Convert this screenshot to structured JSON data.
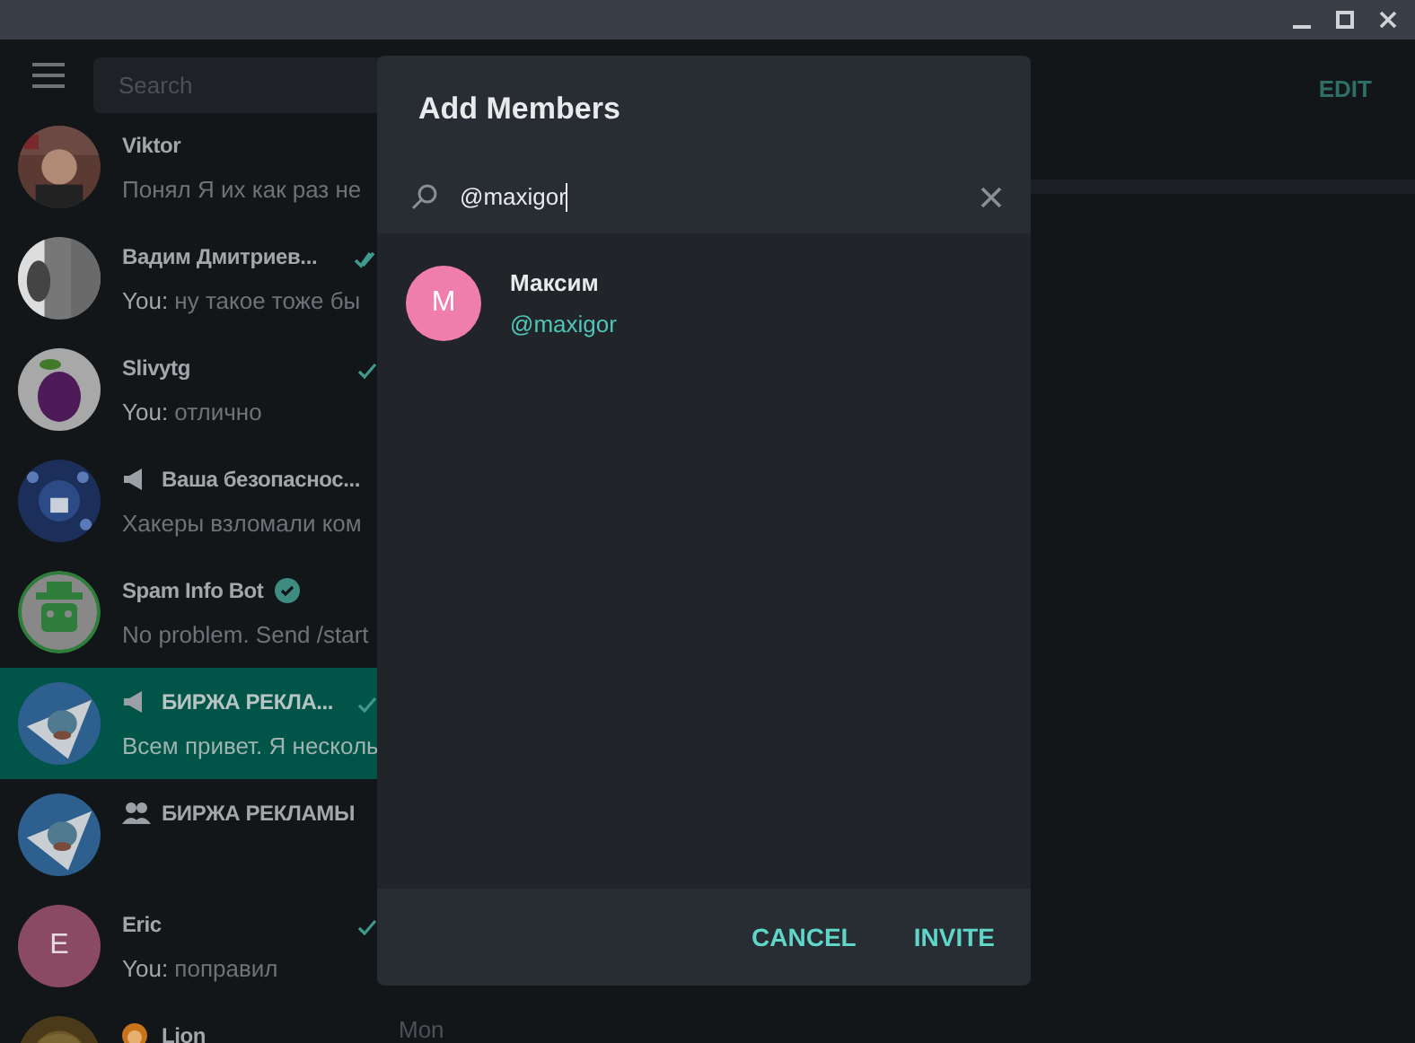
{
  "sidebar": {
    "search": {
      "placeholder": "Search"
    },
    "chats": [
      {
        "kind": "private",
        "name": "Viktor",
        "preview": "Понял Я их как раз не",
        "selected": false
      },
      {
        "kind": "private",
        "name": "Вадим Дмитриев...",
        "sender": "You:",
        "preview": "ну такое тоже бы",
        "sent": true,
        "read": true,
        "selected": false
      },
      {
        "kind": "private",
        "name": "Slivytg",
        "sender": "You:",
        "preview": "отлично",
        "avatar": {
          "kind": "plum"
        },
        "sent": true,
        "read": false,
        "selected": false
      },
      {
        "kind": "channel",
        "name": "Ваша безопаснос...",
        "preview": "Хакеры взломали ком",
        "selected": false
      },
      {
        "kind": "private",
        "name": "Spam Info Bot",
        "preview": "No problem. Send /start",
        "avatar": {
          "kind": "bot"
        },
        "verified": true,
        "selected": false
      },
      {
        "kind": "channel",
        "name": "БИРЖА РЕКЛА...",
        "preview": "Всем привет. Я несколь",
        "sent": true,
        "read": false,
        "selected": true
      },
      {
        "kind": "group",
        "name": "БИРЖА РЕКЛАМЫ",
        "selected": false
      },
      {
        "kind": "private",
        "name": "Eric",
        "sender": "You:",
        "preview": "поправил",
        "avatar": {
          "kind": "letter",
          "letter": "E",
          "color": "#8a4a63"
        },
        "sent": true,
        "read": false,
        "selected": false
      },
      {
        "kind": "emoji",
        "name": "Lion",
        "date": "Mon",
        "selected": false
      }
    ]
  },
  "main": {
    "edit_button": "EDIT"
  },
  "dialog": {
    "title": "Add Members",
    "search": {
      "value": "@maxigor"
    },
    "results": [
      {
        "name": "Максим",
        "username": "@maxigor",
        "avatar": {
          "kind": "letter",
          "letter": "M",
          "color": "#ef7eac"
        }
      }
    ],
    "buttons": [
      "CANCEL",
      "INVITE"
    ]
  }
}
